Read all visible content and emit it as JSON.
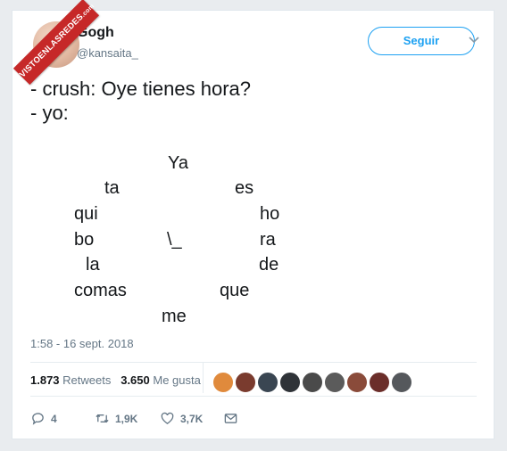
{
  "watermark": {
    "text": "VISTOENLASREDES",
    "sub": ".com"
  },
  "user": {
    "name": "Gogh",
    "handle": "@kansaita_"
  },
  "follow_label": "Seguir",
  "tweet": {
    "line1": "- crush: Oye tienes hora?",
    "line2": "- yo:",
    "poem": [
      "Ya",
      "ta",
      "es",
      "qui",
      "ho",
      "bo",
      "\\_",
      "ra",
      "la",
      "de",
      "comas",
      "que",
      "me"
    ]
  },
  "timestamp": "1:58 - 16 sept. 2018",
  "stats": {
    "retweets_count": "1.873",
    "retweets_label": "Retweets",
    "likes_count": "3.650",
    "likes_label": "Me gusta"
  },
  "actions": {
    "replies": "4",
    "retweets": "1,9K",
    "likes": "3,7K"
  },
  "colors": {
    "accent": "#1da1f2",
    "text": "#14171a",
    "muted": "#657786",
    "ribbon": "#c62828"
  }
}
